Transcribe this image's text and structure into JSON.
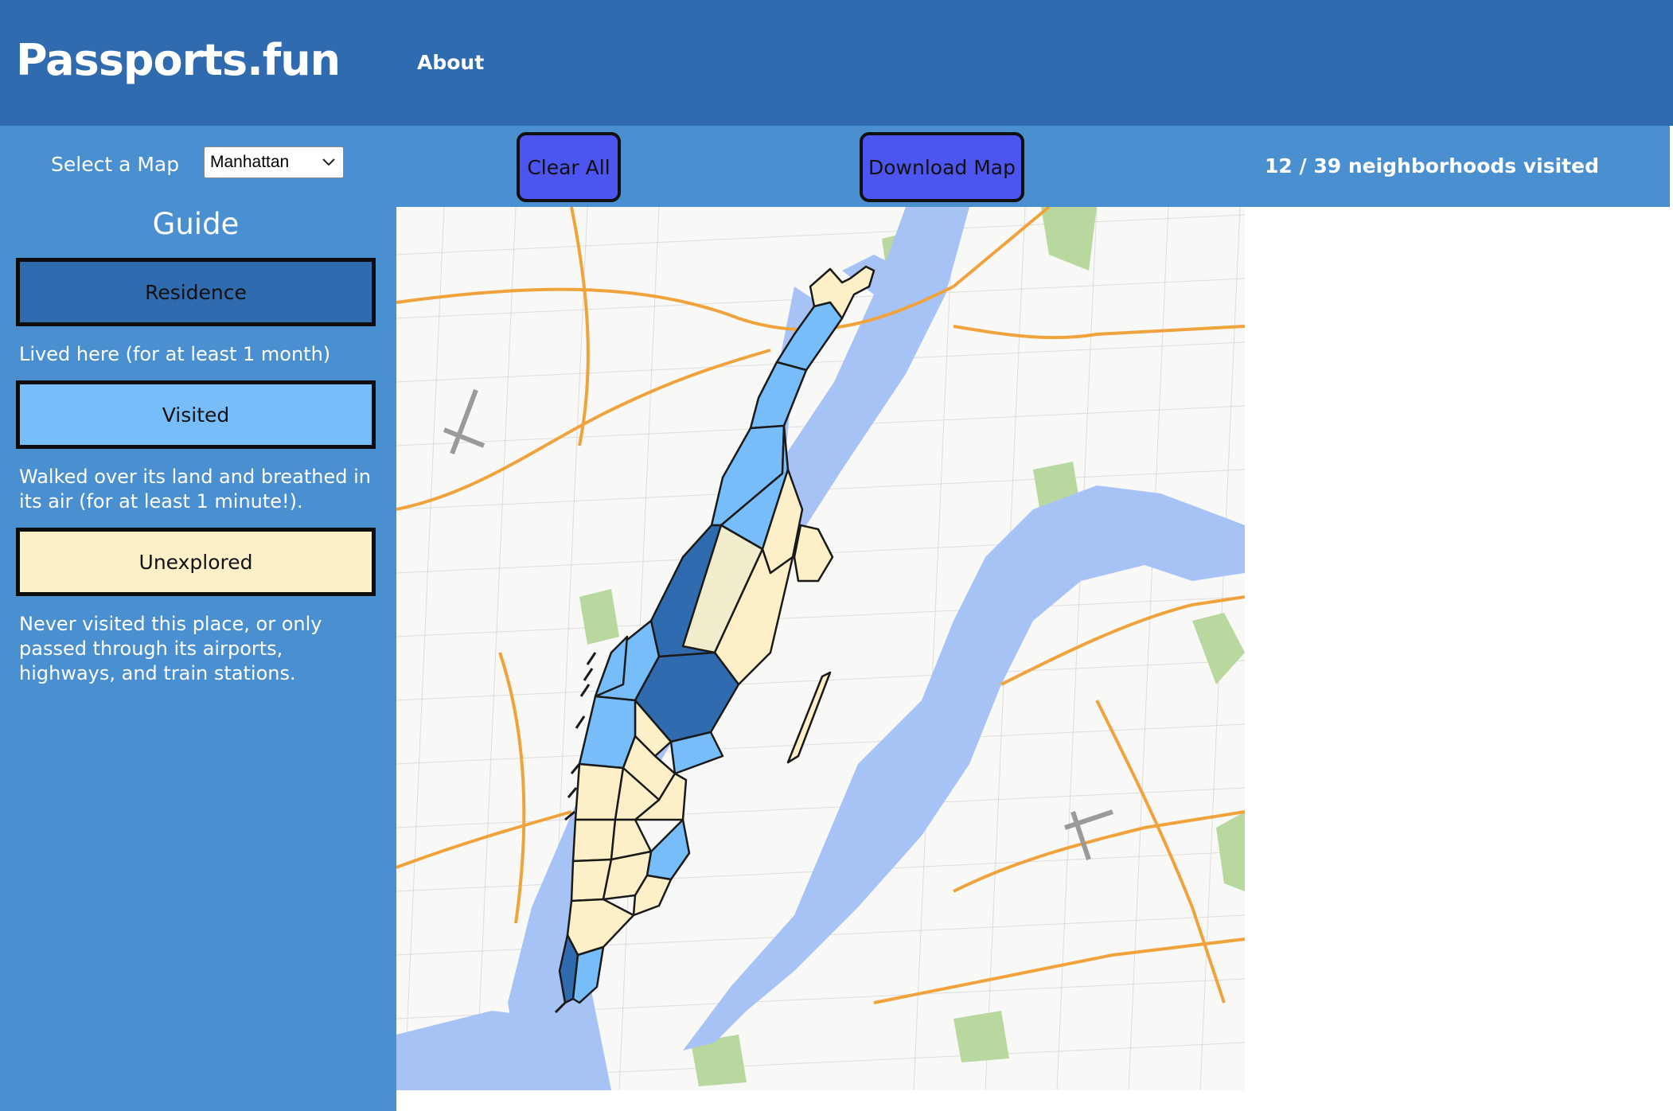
{
  "header": {
    "brand": "Passports.fun",
    "nav_about": "About"
  },
  "toolbar": {
    "select_label": "Select a Map",
    "map_selected": "Manhattan",
    "clear_label": "Clear All",
    "download_label": "Download Map",
    "visited_count": "12 / 39 neighborhoods visited"
  },
  "guide": {
    "title": "Guide",
    "items": [
      {
        "label": "Residence",
        "description": "Lived here (for at least 1 month)",
        "color": "#316baf"
      },
      {
        "label": "Visited",
        "description": "Walked over its land and breathed in its air (for at least 1 minute!).",
        "color": "#76bdfa"
      },
      {
        "label": "Unexplored",
        "description": "Never visited this place, or only passed through its airports, highways, and train stations.",
        "color": "#fdefc7"
      }
    ]
  },
  "map": {
    "borough": "Manhattan",
    "visited": 12,
    "total": 39,
    "water_color": "#a7c2f5",
    "park_color": "#b8d8a0",
    "road_color": "#f0a33c"
  }
}
